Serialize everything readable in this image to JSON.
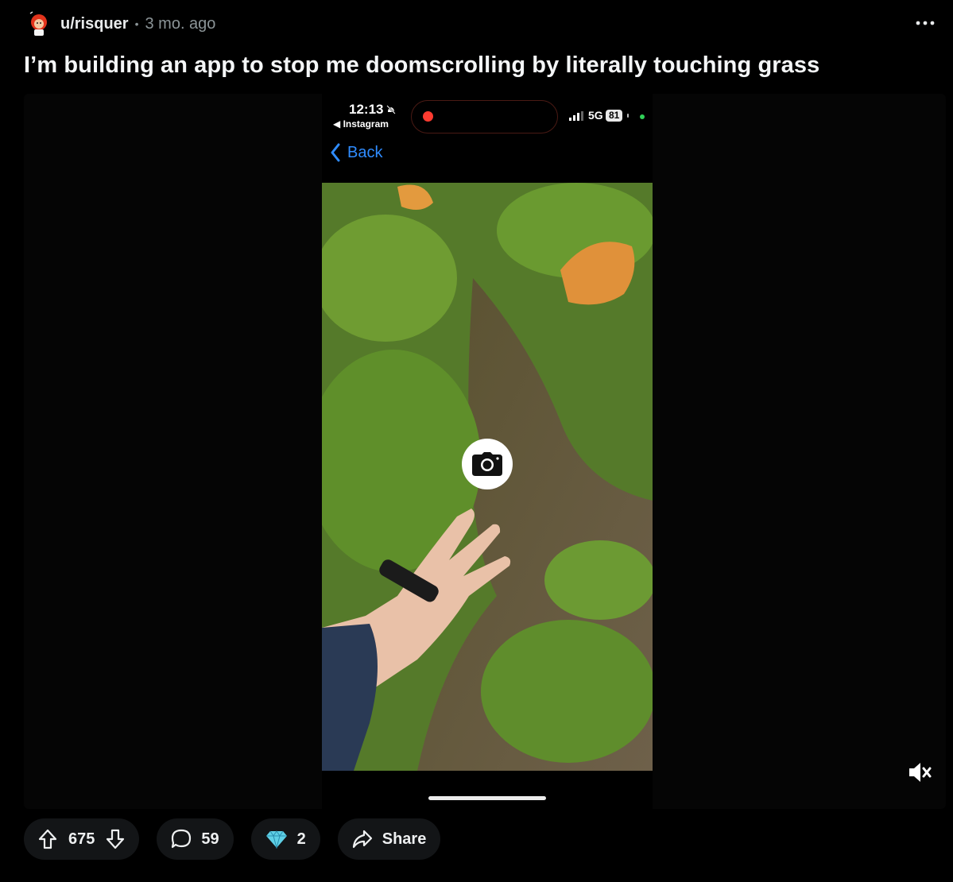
{
  "post": {
    "username": "u/risquer",
    "separator": "•",
    "time_ago": "3 mo. ago",
    "title": "I’m building an app to stop me doomscrolling by literally touching grass"
  },
  "phone": {
    "clock": "12:13",
    "back_app": "◀ Instagram",
    "network": "5G",
    "battery": "81",
    "nav_back_label": "Back",
    "recording_dot_color": "#ff3b30",
    "back_color": "#2f8cff"
  },
  "actions": {
    "upvotes": "675",
    "comments": "59",
    "awards": "2",
    "share_label": "Share"
  },
  "icons": {
    "more": "more-horizontal-icon",
    "mute": "speaker-muted-icon",
    "camera": "camera-icon",
    "upvote": "arrow-up-icon",
    "downvote": "arrow-down-icon",
    "comment": "speech-bubble-icon",
    "award": "gem-icon",
    "share": "share-arrow-icon"
  }
}
